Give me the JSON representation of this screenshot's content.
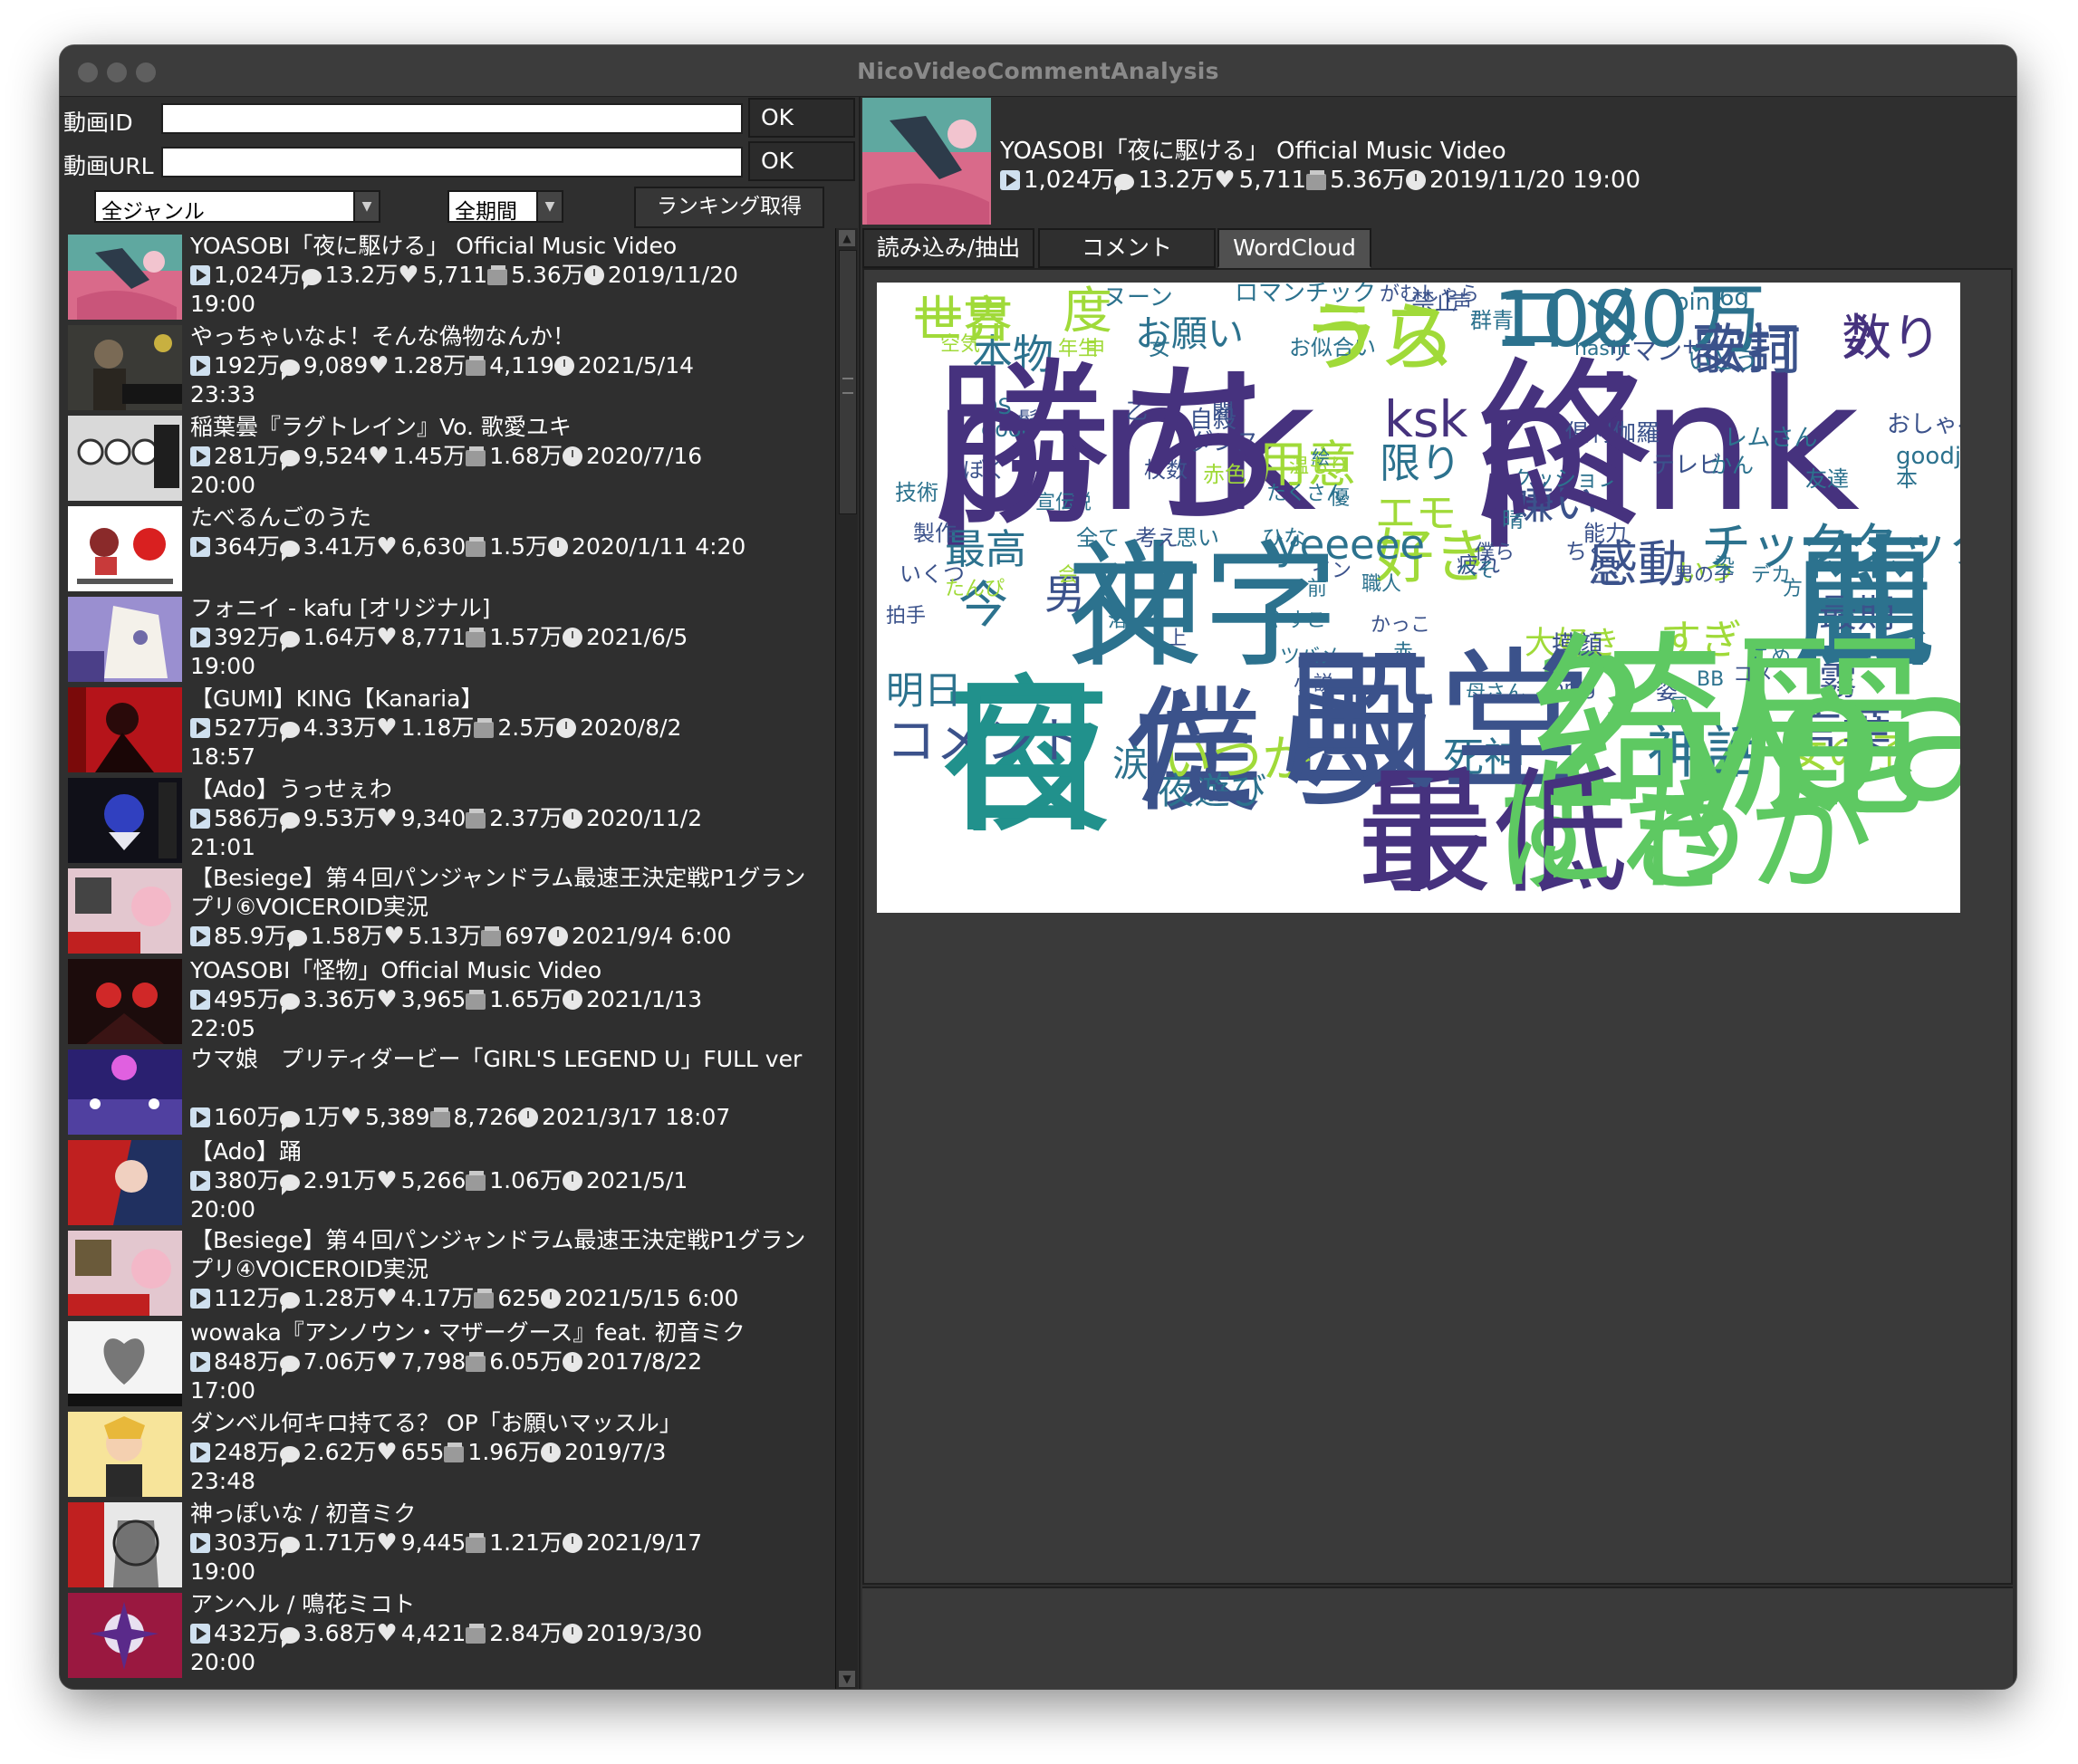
{
  "window": {
    "title": "NicoVideoCommentAnalysis"
  },
  "form": {
    "video_id_label": "動画ID",
    "video_id_value": "",
    "video_url_label": "動画URL",
    "video_url_value": "",
    "ok_label": "OK",
    "genre_select": "全ジャンル",
    "period_select": "全期間",
    "ranking_button": "ランキング取得"
  },
  "ranking": [
    {
      "title": "YOASOBI「夜に駆ける」 Official Music Video",
      "views": "1,024万",
      "comments": "13.2万",
      "likes": "5,711",
      "mylists": "5.36万",
      "date": "2019/11/20",
      "time": "19:00"
    },
    {
      "title": "やっちゃいなよ！そんな偽物なんか！",
      "views": "192万",
      "comments": "9,089",
      "likes": "1.28万",
      "mylists": "4,119",
      "date": "2021/5/14",
      "time": "23:33"
    },
    {
      "title": "稲葉曇『ラグトレイン』Vo. 歌愛ユキ",
      "views": "281万",
      "comments": "9,524",
      "likes": "1.45万",
      "mylists": "1.68万",
      "date": "2020/7/16",
      "time": "20:00"
    },
    {
      "title": "たべるんごのうた",
      "views": "364万",
      "comments": "3.41万",
      "likes": "6,630",
      "mylists": "1.5万",
      "date": "2020/1/11",
      "time": "4:20"
    },
    {
      "title": "フォニイ - kafu [オリジナル]",
      "views": "392万",
      "comments": "1.64万",
      "likes": "8,771",
      "mylists": "1.57万",
      "date": "2021/6/5",
      "time": "19:00"
    },
    {
      "title": "【GUMI】KING【Kanaria】",
      "views": "527万",
      "comments": "4.33万",
      "likes": "1.18万",
      "mylists": "2.5万",
      "date": "2020/8/2",
      "time": "18:57"
    },
    {
      "title": "【Ado】うっせぇわ",
      "views": "586万",
      "comments": "9.53万",
      "likes": "9,340",
      "mylists": "2.37万",
      "date": "2020/11/2",
      "time": "21:01"
    },
    {
      "title": "【Besiege】第４回パンジャンドラム最速王決定戦P1グランプリ⑥VOICEROID実況",
      "views": "85.9万",
      "comments": "1.58万",
      "likes": "5.13万",
      "mylists": "697",
      "date": "2021/9/4",
      "time": "6:00"
    },
    {
      "title": "YOASOBI「怪物」Official Music Video",
      "views": "495万",
      "comments": "3.36万",
      "likes": "3,965",
      "mylists": "1.65万",
      "date": "2021/1/13",
      "time": "22:05"
    },
    {
      "title": "ウマ娘　プリティダービー「GIRL'S LEGEND U」FULL ver",
      "views": "160万",
      "comments": "1万",
      "likes": "5,389",
      "mylists": "8,726",
      "date": "2021/3/17",
      "time": "18:07"
    },
    {
      "title": "【Ado】踊",
      "views": "380万",
      "comments": "2.91万",
      "likes": "5,266",
      "mylists": "1.06万",
      "date": "2021/5/1",
      "time": "20:00"
    },
    {
      "title": "【Besiege】第４回パンジャンドラム最速王決定戦P1グランプリ④VOICEROID実況",
      "views": "112万",
      "comments": "1.28万",
      "likes": "4.17万",
      "mylists": "625",
      "date": "2021/5/15",
      "time": "6:00"
    },
    {
      "title": "wowaka『アンノウン・マザーグース』feat. 初音ミク",
      "views": "848万",
      "comments": "7.06万",
      "likes": "7,798",
      "mylists": "6.05万",
      "date": "2017/8/22",
      "time": "17:00"
    },
    {
      "title": "ダンベル何キロ持てる？ OP「お願いマッスル」",
      "views": "248万",
      "comments": "2.62万",
      "likes": "655",
      "mylists": "1.96万",
      "date": "2019/7/3",
      "time": "23:48"
    },
    {
      "title": "神っぽいな / 初音ミク",
      "views": "303万",
      "comments": "1.71万",
      "likes": "9,445",
      "mylists": "1.21万",
      "date": "2021/9/17",
      "time": "19:00"
    },
    {
      "title": "アンヘル / 鳴花ミコト",
      "views": "432万",
      "comments": "3.68万",
      "likes": "4,421",
      "mylists": "2.84万",
      "date": "2019/3/30",
      "time": "20:00"
    }
  ],
  "selected": {
    "title": "YOASOBI「夜に駆ける」 Official Music Video",
    "views": "1,024万",
    "comments": "13.2万",
    "likes": "5,711",
    "mylists": "5.36万",
    "datetime": "2019/11/20 19:00"
  },
  "tabs": [
    "読み込み/抽出",
    "コメント",
    "WordCloud"
  ],
  "active_tab": "WordCloud",
  "wordcloud": {
    "colors": {
      "purple": "#46327e",
      "teal": "#2c728e",
      "green": "#5ec962",
      "yellowgreen": "#a0da39",
      "darkteal": "#21918c",
      "violet": "#3b528b",
      "yellow": "#dde318"
    },
    "words": [
      "pink",
      "pink",
      "神",
      "曲",
      "夜",
      "僕",
      "画",
      "2",
      "人",
      "手",
      "すき",
      "コメ",
      "ラス",
      "歌詞",
      "入り",
      "世界",
      "度",
      "お願い",
      "本物",
      "ksk",
      "限り",
      "用意",
      "エモ",
      "嫌い",
      "感動",
      "好き",
      "最高",
      "今",
      "男",
      "いつか",
      "死神",
      "女の子",
      "コメント",
      "明日",
      "涙",
      "夜遊び",
      "言葉",
      "霧",
      "最期",
      "すぎ",
      "神話",
      "空",
      "チックタック",
      "yeeeee",
      "大好き",
      "いつ",
      "摸顔",
      "pink",
      "6g",
      "ヌーン",
      "ロマンチック",
      "がむしゃら",
      "禁止",
      "声",
      "群青",
      "空気",
      "年生",
      "申",
      "女",
      "お似合い",
      "hasnt",
      "サマンサ",
      "いとう",
      "自殺",
      "ダンス",
      "DS",
      "good",
      "乙",
      "髪",
      "闇",
      "絵",
      "倶利伽羅",
      "テレビ",
      "レムさん",
      "かん",
      "おしゃべり",
      "goodjob",
      "ぼく",
      "枚数",
      "赤色",
      "クッション",
      "温もり",
      "技術",
      "宣伝",
      "説",
      "たくさん",
      "優",
      "友達",
      "本",
      "製作",
      "全て",
      "考え",
      "思い",
      "ひな",
      "疲れ",
      "僕ら",
      "晴",
      "ちく",
      "能力",
      "いくつ",
      "たんぴ",
      "会",
      "イン",
      "前",
      "職人",
      "へそ",
      "男の子",
      "染",
      "デカ",
      "方",
      "拍手",
      "溶",
      "やすこ",
      "ツバメ",
      "上",
      "小説",
      "かっこ",
      "赤",
      "母さん",
      "omg",
      "姿",
      "風",
      "BB",
      "コメ",
      "こめ",
      "勝ち",
      "終",
      "文字",
      "麗",
      "目",
      "たら",
      "殿堂",
      "綺麗",
      "yoasobi",
      "最低",
      "にわか",
      "1000万",
      "うら",
      "安打",
      "数",
      "一言"
    ]
  }
}
